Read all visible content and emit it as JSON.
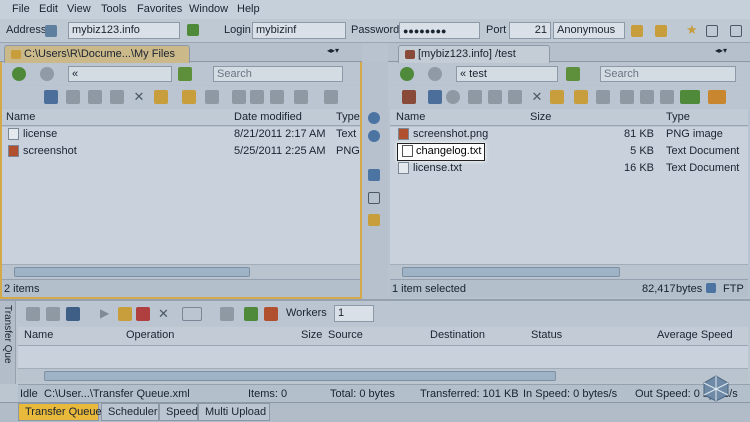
{
  "menu": [
    "File",
    "Edit",
    "View",
    "Tools",
    "Favorites",
    "Window",
    "Help"
  ],
  "connection": {
    "address_label": "Address",
    "address_value": "mybiz123.info",
    "login_label": "Login",
    "login_value": "mybizinf",
    "password_label": "Password",
    "password_value": "●●●●●●●●",
    "port_label": "Port",
    "port_value": "21",
    "mode_value": "Anonymous"
  },
  "left_panel": {
    "tab_title": "C:\\Users\\R\\Docume...\\My Files",
    "path": "«",
    "search_placeholder": "Search",
    "columns": [
      "Name",
      "Date modified",
      "Type"
    ],
    "rows": [
      {
        "name": "license",
        "date": "8/21/2011 2:17 AM",
        "type": "Text"
      },
      {
        "name": "screenshot",
        "date": "5/25/2011 2:25 AM",
        "type": "PNG"
      }
    ],
    "status": "2 items"
  },
  "right_panel": {
    "tab_title": "[mybiz123.info] /test",
    "path": "« test",
    "search_placeholder": "Search",
    "columns": [
      "Name",
      "Size",
      "Type"
    ],
    "rows": [
      {
        "name": "screenshot.png",
        "size": "81 KB",
        "type": "PNG image"
      },
      {
        "name": "changelog.txt",
        "size": "5 KB",
        "type": "Text Document"
      },
      {
        "name": "license.txt",
        "size": "16 KB",
        "type": "Text Document"
      }
    ],
    "status": "1 item selected",
    "status_bytes": "82,417",
    "status_bytes_unit": "bytes",
    "status_protocol": "FTP"
  },
  "transfer": {
    "side_label": "Transfer Que",
    "workers_label": "Workers",
    "workers_value": "1",
    "columns": [
      "Name",
      "Operation",
      "Size",
      "Source",
      "Destination",
      "Status",
      "Average Speed"
    ],
    "status": {
      "state": "Idle",
      "file": "C:\\User...\\Transfer Queue.xml",
      "items": "Items: 0",
      "total": "Total: 0 bytes",
      "transferred": "Transferred: 101 KB",
      "in_speed": "In Speed: 0 bytes/s",
      "out_speed": "Out Speed: 0 bytes/s"
    }
  },
  "bottom_tabs": [
    "Transfer Queue",
    "Scheduler",
    "Speed",
    "Multi Upload"
  ],
  "colors": {
    "accent": "#e8b93a",
    "selected_tab": "#f0c75a"
  }
}
